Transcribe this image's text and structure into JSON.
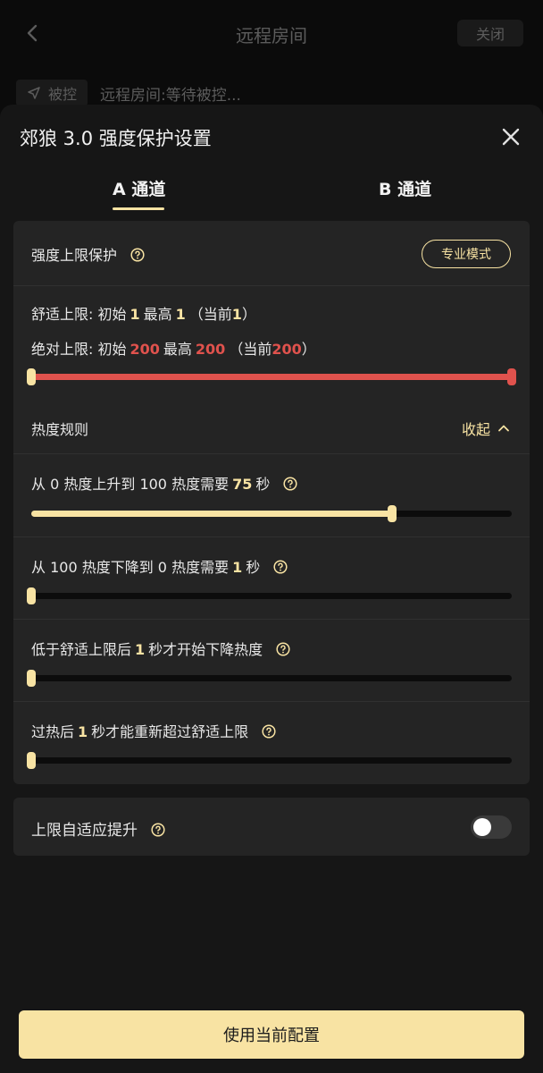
{
  "header": {
    "title": "远程房间",
    "close_label": "关闭"
  },
  "control": {
    "chip_label": "被控",
    "status_text": "远程房间:等待被控..."
  },
  "sheet": {
    "title": "郊狼 3.0 强度保护设置",
    "tabs": [
      {
        "label": "A 通道",
        "active": true
      },
      {
        "label": "B 通道",
        "active": false
      }
    ]
  },
  "strength_protection": {
    "title": "强度上限保护",
    "pro_mode_label": "专业模式",
    "comfort": {
      "prefix": "舒适上限: 初始",
      "initial": "1",
      "max_text": "最高",
      "max": "1",
      "current_prefix": "（当前",
      "current": "1",
      "current_suffix": "）"
    },
    "absolute": {
      "prefix": "绝对上限: 初始",
      "initial": "200",
      "max_text": "最高",
      "max": "200",
      "current_prefix": "（当前",
      "current": "200",
      "current_suffix": "）"
    },
    "range_slider": {
      "low_fraction": 0.0,
      "high_fraction": 1.0
    }
  },
  "heat_rules": {
    "title": "热度规则",
    "collapse_label": "收起",
    "rules": [
      {
        "before": "从 0 热度上升到 100 热度需要",
        "value": "75",
        "after": "秒",
        "fraction": 0.75
      },
      {
        "before": "从 100 热度下降到 0 热度需要",
        "value": "1",
        "after": "秒",
        "fraction": 0.0
      },
      {
        "before": "低于舒适上限后",
        "value": "1",
        "after": "秒才开始下降热度",
        "fraction": 0.0
      },
      {
        "before": "过热后",
        "value": "1",
        "after": "秒才能重新超过舒适上限",
        "fraction": 0.0
      }
    ]
  },
  "adaptive": {
    "label": "上限自适应提升",
    "enabled": false
  },
  "apply_label": "使用当前配置",
  "colors": {
    "accent": "#f8e3a3",
    "danger": "#e0524d",
    "card": "#242424",
    "sheet": "#161616"
  },
  "icons": [
    "chevron-left-icon",
    "send-icon",
    "close-icon",
    "help-circle-icon",
    "chevron-up-icon"
  ]
}
